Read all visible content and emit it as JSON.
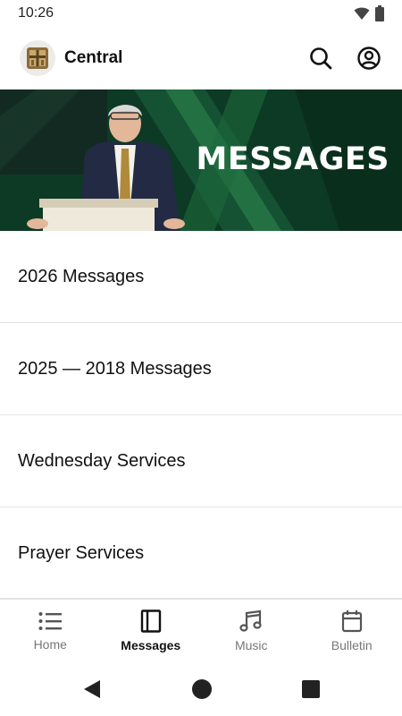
{
  "status": {
    "time": "10:26"
  },
  "header": {
    "title": "Central"
  },
  "banner": {
    "title": "MESSAGES"
  },
  "menu": [
    {
      "label": "2026 Messages"
    },
    {
      "label": "2025 — 2018 Messages"
    },
    {
      "label": "Wednesday Services"
    },
    {
      "label": "Prayer Services"
    }
  ],
  "nav": [
    {
      "label": "Home",
      "icon": "list-icon"
    },
    {
      "label": "Messages",
      "icon": "book-icon",
      "active": true
    },
    {
      "label": "Music",
      "icon": "music-note-icon"
    },
    {
      "label": "Bulletin",
      "icon": "calendar-icon"
    }
  ],
  "colors": {
    "banner_green": "#0d3a24",
    "banner_accent": "#2f8a4e",
    "active_nav": "#111111",
    "inactive_nav": "#777777"
  }
}
